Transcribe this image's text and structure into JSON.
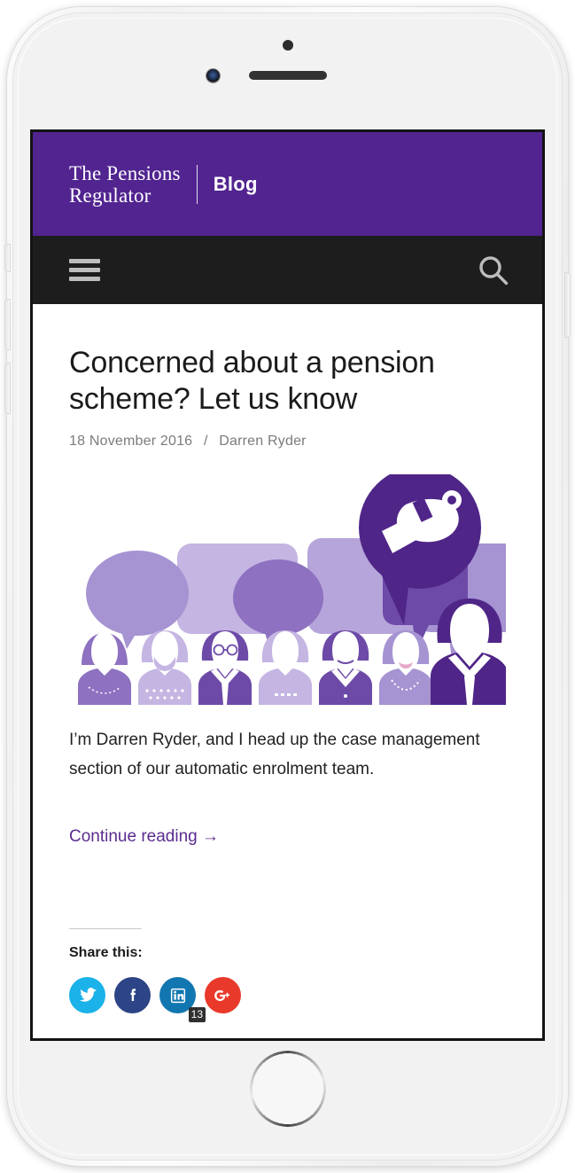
{
  "device": {
    "type": "white-iphone-mockup",
    "components": {
      "sensor": "proximity-sensor",
      "speaker": "earpiece-speaker",
      "camera": "front-camera",
      "home": "home-button"
    }
  },
  "header": {
    "brand_name": "The Pensions\nRegulator",
    "brand_sub": "Blog",
    "background_color": "#512490"
  },
  "nav": {
    "menu_icon": "hamburger-menu-icon",
    "search_icon": "search-icon",
    "background_color": "#1d1d1d"
  },
  "post": {
    "title": "Concerned about a pension scheme? Let us know",
    "date": "18 November 2016",
    "separator": "/",
    "author": "Darren Ryder",
    "body": "I’m Darren Ryder, and I head up the case management section of our automatic enrolment team.",
    "continue_label": "Continue reading →",
    "link_color": "#5b2c90",
    "hero": {
      "alt": "whistleblowing-illustration",
      "description": "Row of seven people with speech bubbles and a whistle in a speech bubble",
      "colors": {
        "darkest": "#4f2588",
        "dark": "#6d4aa8",
        "mid": "#8e71c0",
        "light": "#ab96d3",
        "lightest": "#c4b5e2"
      }
    }
  },
  "share": {
    "label": "Share this:",
    "buttons": [
      {
        "name": "twitter",
        "icon": "twitter-icon",
        "color": "#1ab2e8",
        "count": ""
      },
      {
        "name": "facebook",
        "icon": "facebook-icon",
        "color": "#2d4486",
        "count": ""
      },
      {
        "name": "linkedin",
        "icon": "linkedin-icon",
        "color": "#1277b0",
        "count": "13"
      },
      {
        "name": "googleplus",
        "icon": "google-plus-icon",
        "color": "#e8392b",
        "count": ""
      }
    ]
  }
}
